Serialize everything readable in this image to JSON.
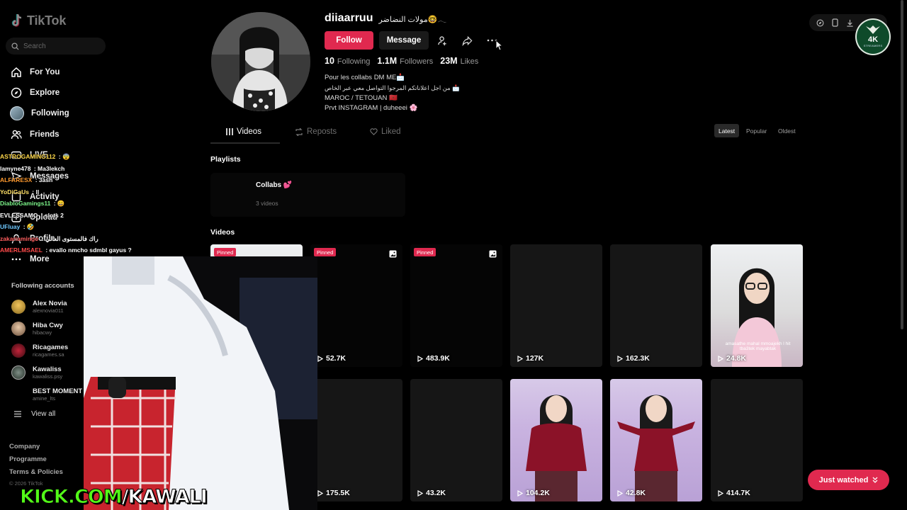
{
  "brand": {
    "name": "TikTok",
    "accent": "#e0294f"
  },
  "search": {
    "placeholder": "Search"
  },
  "nav": [
    {
      "label": "For You",
      "icon": "home-icon"
    },
    {
      "label": "Explore",
      "icon": "compass-icon"
    },
    {
      "label": "Following",
      "icon": "following-avatar"
    },
    {
      "label": "Friends",
      "icon": "friends-icon"
    },
    {
      "label": "LIVE",
      "icon": "live-icon"
    },
    {
      "label": "Messages",
      "icon": "messages-icon"
    },
    {
      "label": "Activity",
      "icon": "activity-icon"
    },
    {
      "label": "Upload",
      "icon": "upload-icon"
    },
    {
      "label": "Profile",
      "icon": "profile-icon"
    },
    {
      "label": "More",
      "icon": "more-icon"
    }
  ],
  "following_accounts": {
    "title": "Following accounts",
    "items": [
      {
        "name": "Alex Novia",
        "handle": "alexnovia011"
      },
      {
        "name": "Hiba Cwy",
        "handle": "hibacwy"
      },
      {
        "name": "Ricagames",
        "handle": "ricagames.sa"
      },
      {
        "name": "Kawaliss",
        "handle": "kawaliss.psy"
      },
      {
        "name": "BEST MOMENT",
        "handle": "amine_lts"
      }
    ],
    "view_all": "View all"
  },
  "footer": {
    "links": [
      "Company",
      "Programme",
      "Terms & Policies"
    ],
    "copyright": "© 2026 TikTok"
  },
  "chat": [
    {
      "user": "ASTROGAMING112",
      "msg": "😨",
      "color": "#ffd84a"
    },
    {
      "user": "lamyne478",
      "msg": "Ma3lekch",
      "color": "#ffffff"
    },
    {
      "user": "ALFARESX",
      "msg": "3ash",
      "color": "#ff9a2e"
    },
    {
      "user": "YoDiGaUs",
      "msg": "ll",
      "color": "#ffe066"
    },
    {
      "user": "DiabloGamings11",
      "msg": "😄",
      "color": "#7cf58a"
    },
    {
      "user": "EVLESSAMO",
      "msg": "slots 2",
      "color": "#ffffff"
    },
    {
      "user": "UFluay",
      "msg": "🤣",
      "color": "#6ec8ff"
    },
    {
      "user": "zakariamingo",
      "msg": "راك فالمستوى العالي",
      "color": "#ff5e5e"
    },
    {
      "user": "AMERLMSAEL",
      "msg": "evallo nmcho sdmbl gayus ?",
      "color": "#ff4a4a"
    }
  ],
  "profile": {
    "username": "diiaarruu",
    "display_name": "مولات النضاضر🤓𓂃",
    "follow_label": "Follow",
    "message_label": "Message",
    "stats": [
      {
        "value": "10",
        "label": "Following"
      },
      {
        "value": "1.1M",
        "label": "Followers"
      },
      {
        "value": "23M",
        "label": "Likes"
      }
    ],
    "bio": [
      "Pour les collabs DM ME📩",
      "من اجل اعلاناتكم المرجوا التواصل معي عبر الخاص 📩",
      "MAROC / TETOUAN 🇲🇦",
      "Prvt INSTAGRAM | duheeei 🌸"
    ]
  },
  "tabs": {
    "videos": "Videos",
    "reposts": "Reposts",
    "liked": "Liked"
  },
  "sort": [
    "Latest",
    "Popular",
    "Oldest"
  ],
  "playlists": {
    "title": "Playlists",
    "items": [
      {
        "name": "Collabs 💕",
        "count": "3 videos"
      }
    ]
  },
  "videos": {
    "title": "Videos",
    "pinned_label": "Pinned",
    "items": [
      {
        "views": "",
        "pinned": true
      },
      {
        "views": "52.7K",
        "pinned": true,
        "multi": true
      },
      {
        "views": "483.9K",
        "pinned": true,
        "multi": true
      },
      {
        "views": "127K"
      },
      {
        "views": "162.3K"
      },
      {
        "views": "24.8K",
        "caption": "amasathe mahal mmoajekh l hit tba3tek mayabtak"
      },
      {
        "views": ""
      },
      {
        "views": "175.5K"
      },
      {
        "views": "43.2K"
      },
      {
        "views": "104.2K"
      },
      {
        "views": "42.8K"
      },
      {
        "views": "414.7K"
      }
    ]
  },
  "just_watched": "Just watched",
  "watermark": {
    "part1": "KICK.COM",
    "part2": "/KAWALI"
  },
  "channel_badge": {
    "title": "4K",
    "subtitle": "STREAMERS"
  }
}
